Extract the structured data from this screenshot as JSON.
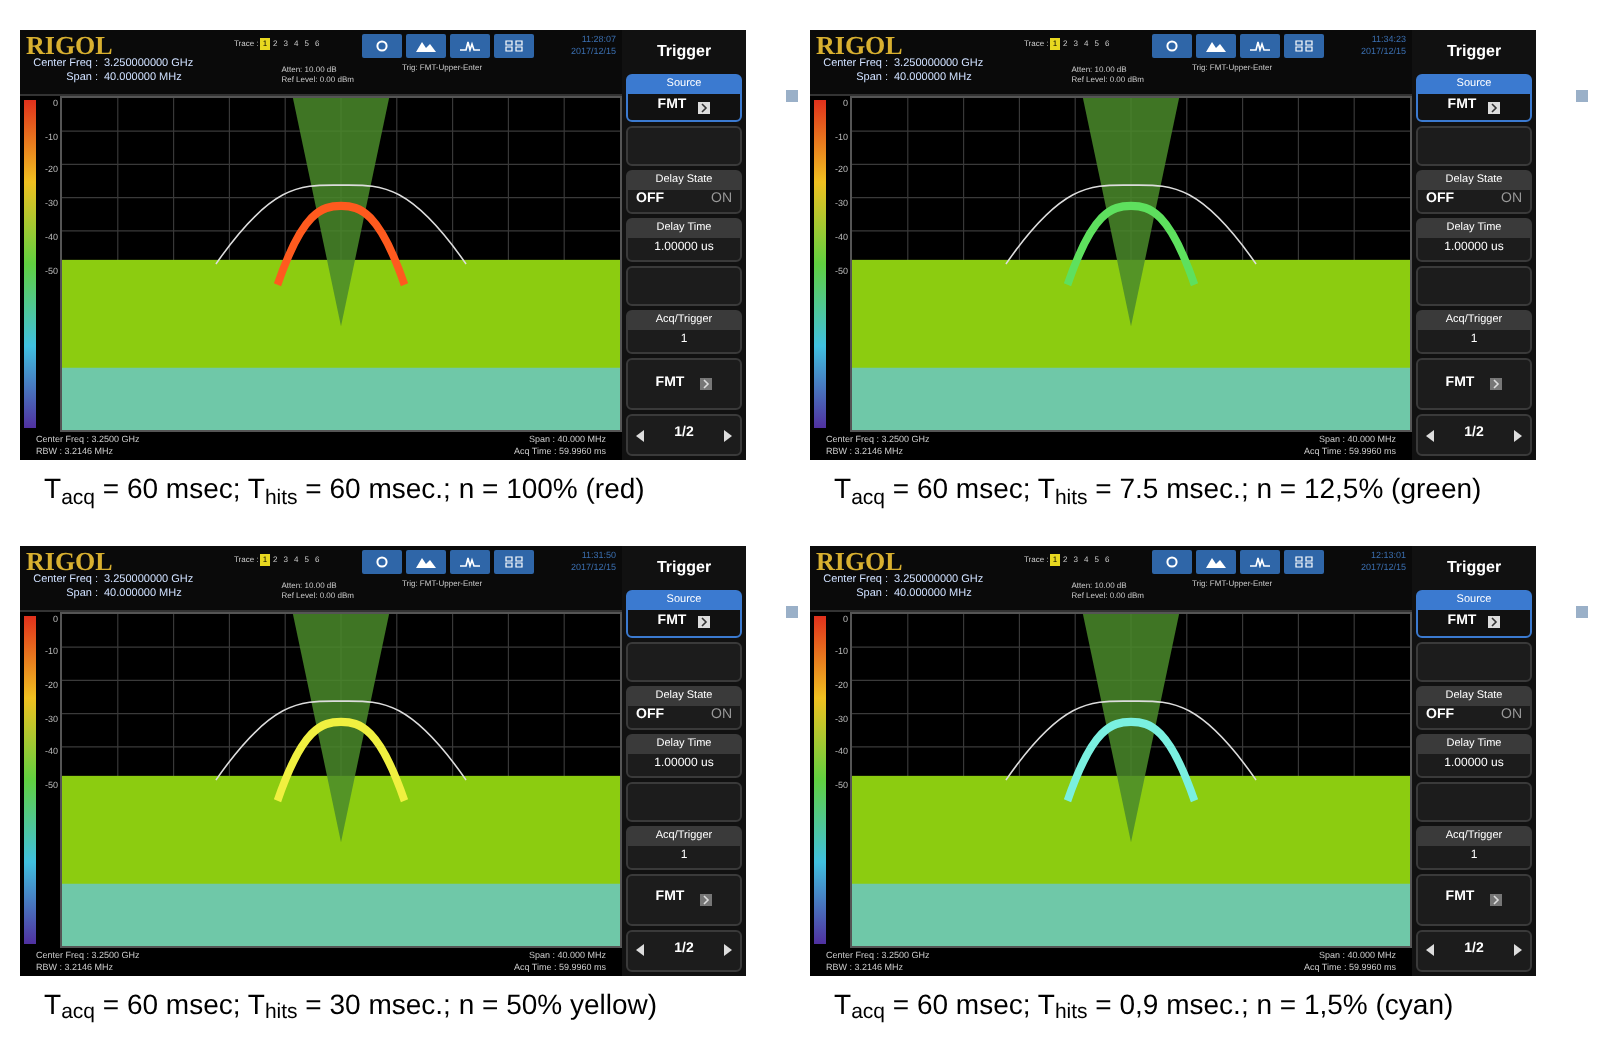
{
  "panels": [
    {
      "logo": "RIGOL",
      "center_freq_label": "Center Freq :",
      "center_freq": "3.250000000 GHz",
      "span_label": "Span :",
      "span": "40.000000 MHz",
      "trace_label": "Trace :",
      "traces": [
        "1",
        "2",
        "3",
        "4",
        "5",
        "6"
      ],
      "atten": "Atten: 10.00 dB",
      "ref_level": "Ref Level: 0.00 dBm",
      "trig": "Trig: FMT-Upper-Enter",
      "time": "11:28:07",
      "date": "2017/12/15",
      "yticks": [
        "0",
        "-10",
        "-20",
        "-30",
        "-40",
        "-50"
      ],
      "footer_center": "Center Freq : 3.2500 GHz",
      "footer_rbw": "RBW : 3.2146 MHz",
      "footer_span": "Span : 40.000 MHz",
      "footer_acq": "Acq Time : 59.9960 ms",
      "color": "#ff5a1e",
      "menu": {
        "title": "Trigger",
        "source_label": "Source",
        "source_value": "FMT",
        "delay_state_label": "Delay State",
        "off": "OFF",
        "on": "ON",
        "delay_time_label": "Delay Time",
        "delay_time": "1.00000 us",
        "acq_label": "Acq/Trigger",
        "acq_value": "1",
        "fmt": "FMT",
        "page": "1/2"
      },
      "caption": "T$_{acq}$ = 60 msec; T$_{hits}$ = 60 msec.; n = 100% (red)"
    },
    {
      "logo": "RIGOL",
      "center_freq_label": "Center Freq :",
      "center_freq": "3.250000000 GHz",
      "span_label": "Span :",
      "span": "40.000000 MHz",
      "trace_label": "Trace :",
      "traces": [
        "1",
        "2",
        "3",
        "4",
        "5",
        "6"
      ],
      "atten": "Atten: 10.00 dB",
      "ref_level": "Ref Level: 0.00 dBm",
      "trig": "Trig: FMT-Upper-Enter",
      "time": "11:34:23",
      "date": "2017/12/15",
      "yticks": [
        "0",
        "-10",
        "-20",
        "-30",
        "-40",
        "-50"
      ],
      "footer_center": "Center Freq : 3.2500 GHz",
      "footer_rbw": "RBW : 3.2146 MHz",
      "footer_span": "Span : 40.000 MHz",
      "footer_acq": "Acq Time : 59.9960 ms",
      "color": "#5ee05e",
      "menu": {
        "title": "Trigger",
        "source_label": "Source",
        "source_value": "FMT",
        "delay_state_label": "Delay State",
        "off": "OFF",
        "on": "ON",
        "delay_time_label": "Delay Time",
        "delay_time": "1.00000 us",
        "acq_label": "Acq/Trigger",
        "acq_value": "1",
        "fmt": "FMT",
        "page": "1/2"
      },
      "caption": "T$_{acq}$ = 60 msec; T$_{hits}$ = 7.5 msec.; n = 12,5% (green)"
    },
    {
      "logo": "RIGOL",
      "center_freq_label": "Center Freq :",
      "center_freq": "3.250000000 GHz",
      "span_label": "Span :",
      "span": "40.000000 MHz",
      "trace_label": "Trace :",
      "traces": [
        "1",
        "2",
        "3",
        "4",
        "5",
        "6"
      ],
      "atten": "Atten: 10.00 dB",
      "ref_level": "Ref Level: 0.00 dBm",
      "trig": "Trig: FMT-Upper-Enter",
      "time": "11:31:50",
      "date": "2017/12/15",
      "yticks": [
        "0",
        "-10",
        "-20",
        "-30",
        "-40",
        "-50"
      ],
      "footer_center": "Center Freq : 3.2500 GHz",
      "footer_rbw": "RBW : 3.2146 MHz",
      "footer_span": "Span : 40.000 MHz",
      "footer_acq": "Acq Time : 59.9960 ms",
      "color": "#f0f040",
      "menu": {
        "title": "Trigger",
        "source_label": "Source",
        "source_value": "FMT",
        "delay_state_label": "Delay State",
        "off": "OFF",
        "on": "ON",
        "delay_time_label": "Delay Time",
        "delay_time": "1.00000 us",
        "acq_label": "Acq/Trigger",
        "acq_value": "1",
        "fmt": "FMT",
        "page": "1/2"
      },
      "caption": "T$_{acq}$ = 60 msec; T$_{hits}$ = 30 msec.; n = 50% yellow)"
    },
    {
      "logo": "RIGOL",
      "center_freq_label": "Center Freq :",
      "center_freq": "3.250000000 GHz",
      "span_label": "Span :",
      "span": "40.000000 MHz",
      "trace_label": "Trace :",
      "traces": [
        "1",
        "2",
        "3",
        "4",
        "5",
        "6"
      ],
      "atten": "Atten: 10.00 dB",
      "ref_level": "Ref Level: 0.00 dBm",
      "trig": "Trig: FMT-Upper-Enter",
      "time": "12:13:01",
      "date": "2017/12/15",
      "yticks": [
        "0",
        "-10",
        "-20",
        "-30",
        "-40",
        "-50"
      ],
      "footer_center": "Center Freq : 3.2500 GHz",
      "footer_rbw": "RBW : 3.2146 MHz",
      "footer_span": "Span : 40.000 MHz",
      "footer_acq": "Acq Time : 59.9960 ms",
      "color": "#7af0e0",
      "menu": {
        "title": "Trigger",
        "source_label": "Source",
        "source_value": "FMT",
        "delay_state_label": "Delay State",
        "off": "OFF",
        "on": "ON",
        "delay_time_label": "Delay Time",
        "delay_time": "1.00000 us",
        "acq_label": "Acq/Trigger",
        "acq_value": "1",
        "fmt": "FMT",
        "page": "1/2"
      },
      "caption": "T$_{acq}$ = 60 msec; T$_{hits}$ = 0,9 msec.; n = 1,5% (cyan)"
    }
  ]
}
